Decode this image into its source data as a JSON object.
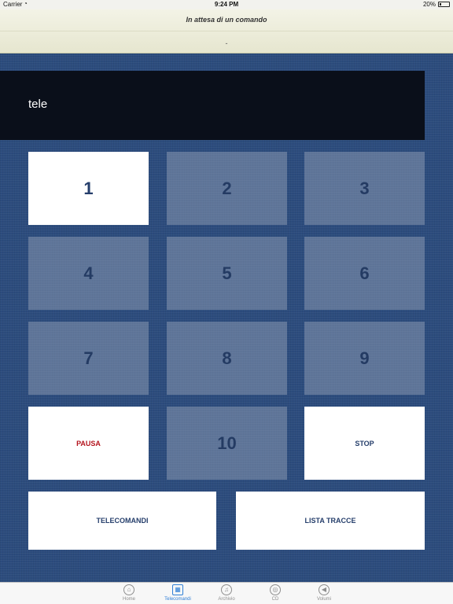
{
  "status_bar": {
    "carrier": "Carrier",
    "time": "9:24 PM",
    "battery": "20%"
  },
  "header": {
    "status_message": "In attesa di un comando",
    "track_info": "-"
  },
  "display": {
    "text": "tele"
  },
  "keypad": {
    "keys": [
      "1",
      "2",
      "3",
      "4",
      "5",
      "6",
      "7",
      "8",
      "9",
      "10"
    ],
    "pause_label": "PAUSA",
    "stop_label": "STOP",
    "remotes_label": "TELECOMANDI",
    "tracklist_label": "LISTA TRACCE"
  },
  "colors": {
    "background": "#2c4c7d",
    "display": "#0a0f1a",
    "pause_text": "#b4141e",
    "key_text": "#253e6b",
    "tab_active": "#2f7fd6"
  },
  "tab_bar": {
    "items": [
      {
        "label": "Home",
        "icon": "home-icon"
      },
      {
        "label": "Telecomandi",
        "icon": "grid-icon"
      },
      {
        "label": "Archivio",
        "icon": "music-note-icon"
      },
      {
        "label": "CD",
        "icon": "cd-icon"
      },
      {
        "label": "Volumi",
        "icon": "speaker-icon"
      }
    ]
  }
}
